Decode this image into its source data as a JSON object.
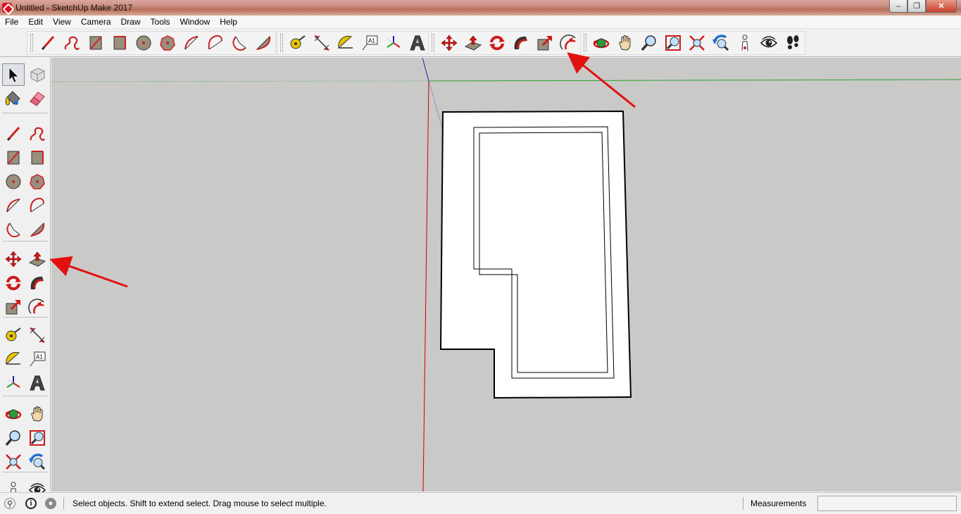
{
  "window": {
    "title": "Untitled - SketchUp Make 2017",
    "minimize": "–",
    "maximize": "❐",
    "close": "✕"
  },
  "menu": [
    "File",
    "Edit",
    "View",
    "Camera",
    "Draw",
    "Tools",
    "Window",
    "Help"
  ],
  "toolbar_top": [
    {
      "name": "line-tool",
      "icon": "pencil-icon"
    },
    {
      "name": "freehand-tool",
      "icon": "freehand-icon"
    },
    {
      "name": "rectangle-tool",
      "icon": "rectangle-icon"
    },
    {
      "name": "rotated-rectangle-tool",
      "icon": "rotated-rectangle-icon"
    },
    {
      "name": "circle-tool",
      "icon": "circle-icon"
    },
    {
      "name": "polygon-tool",
      "icon": "polygon-icon"
    },
    {
      "name": "arc-tool",
      "icon": "arc-icon"
    },
    {
      "name": "2-point-arc-tool",
      "icon": "two-point-arc-icon"
    },
    {
      "name": "3-point-arc-tool",
      "icon": "three-point-arc-icon"
    },
    {
      "name": "pie-tool",
      "icon": "pie-icon"
    },
    {
      "name": "tape-measure-tool",
      "icon": "tape-measure-icon"
    },
    {
      "name": "dimension-tool",
      "icon": "dimension-icon"
    },
    {
      "name": "protractor-tool",
      "icon": "protractor-icon"
    },
    {
      "name": "text-tool",
      "icon": "text-label-icon",
      "label": "A1"
    },
    {
      "name": "axes-tool",
      "icon": "axes-icon"
    },
    {
      "name": "3d-text-tool",
      "icon": "3d-text-icon"
    },
    {
      "name": "move-tool",
      "icon": "move-icon"
    },
    {
      "name": "push-pull-tool",
      "icon": "push-pull-icon"
    },
    {
      "name": "rotate-tool",
      "icon": "rotate-icon"
    },
    {
      "name": "follow-me-tool",
      "icon": "follow-me-icon"
    },
    {
      "name": "scale-tool",
      "icon": "scale-icon"
    },
    {
      "name": "offset-tool",
      "icon": "offset-icon"
    },
    {
      "name": "orbit-tool",
      "icon": "orbit-icon"
    },
    {
      "name": "pan-tool",
      "icon": "pan-hand-icon"
    },
    {
      "name": "zoom-tool",
      "icon": "zoom-icon"
    },
    {
      "name": "zoom-window-tool",
      "icon": "zoom-window-icon"
    },
    {
      "name": "zoom-extents-tool",
      "icon": "zoom-extents-icon"
    },
    {
      "name": "previous-view-tool",
      "icon": "previous-view-icon"
    },
    {
      "name": "position-camera-tool",
      "icon": "position-camera-icon"
    },
    {
      "name": "look-around-tool",
      "icon": "eye-icon"
    },
    {
      "name": "walk-tool",
      "icon": "footprints-icon"
    }
  ],
  "toolbar_left": [
    {
      "name": "select-tool",
      "icon": "select-arrow-icon",
      "selected": true
    },
    {
      "name": "make-component-tool",
      "icon": "component-icon"
    },
    {
      "name": "paint-bucket-tool",
      "icon": "paint-bucket-icon"
    },
    {
      "name": "eraser-tool",
      "icon": "eraser-icon"
    },
    {
      "name": "line-tool",
      "icon": "pencil-icon"
    },
    {
      "name": "freehand-tool",
      "icon": "freehand-icon"
    },
    {
      "name": "rectangle-tool",
      "icon": "rectangle-icon"
    },
    {
      "name": "rotated-rectangle-tool",
      "icon": "rotated-rectangle-icon"
    },
    {
      "name": "circle-tool",
      "icon": "circle-icon"
    },
    {
      "name": "polygon-tool",
      "icon": "polygon-icon"
    },
    {
      "name": "arc-tool",
      "icon": "arc-icon"
    },
    {
      "name": "2-point-arc-tool",
      "icon": "two-point-arc-icon"
    },
    {
      "name": "3-point-arc-tool",
      "icon": "three-point-arc-icon"
    },
    {
      "name": "pie-tool",
      "icon": "pie-icon"
    },
    {
      "name": "move-tool",
      "icon": "move-icon"
    },
    {
      "name": "push-pull-tool",
      "icon": "push-pull-icon"
    },
    {
      "name": "rotate-tool",
      "icon": "rotate-icon"
    },
    {
      "name": "follow-me-tool",
      "icon": "follow-me-icon"
    },
    {
      "name": "scale-tool",
      "icon": "scale-icon"
    },
    {
      "name": "offset-tool",
      "icon": "offset-icon"
    },
    {
      "name": "tape-measure-tool",
      "icon": "tape-measure-icon"
    },
    {
      "name": "dimension-tool",
      "icon": "dimension-icon"
    },
    {
      "name": "protractor-tool",
      "icon": "protractor-icon"
    },
    {
      "name": "text-tool",
      "icon": "text-label-icon",
      "label": "A1"
    },
    {
      "name": "axes-tool",
      "icon": "axes-icon"
    },
    {
      "name": "3d-text-tool",
      "icon": "3d-text-icon"
    },
    {
      "name": "orbit-tool",
      "icon": "orbit-icon"
    },
    {
      "name": "pan-tool",
      "icon": "pan-hand-icon"
    },
    {
      "name": "zoom-tool",
      "icon": "zoom-icon"
    },
    {
      "name": "zoom-window-tool",
      "icon": "zoom-window-icon"
    },
    {
      "name": "zoom-extents-tool",
      "icon": "zoom-extents-icon"
    },
    {
      "name": "previous-view-tool",
      "icon": "previous-view-icon"
    },
    {
      "name": "position-camera-tool",
      "icon": "position-camera-icon"
    },
    {
      "name": "look-around-tool",
      "icon": "eye-icon"
    }
  ],
  "status": {
    "message": "Select objects. Shift to extend select. Drag mouse to select multiple.",
    "measurements_label": "Measurements",
    "measurements_value": ""
  },
  "colors": {
    "canvas_bg": "#c9c9c8",
    "red_axis": "#cc0000",
    "green_axis": "#2aa02a",
    "blue_axis": "#2020c0",
    "annotation_arrow": "#e31010"
  }
}
